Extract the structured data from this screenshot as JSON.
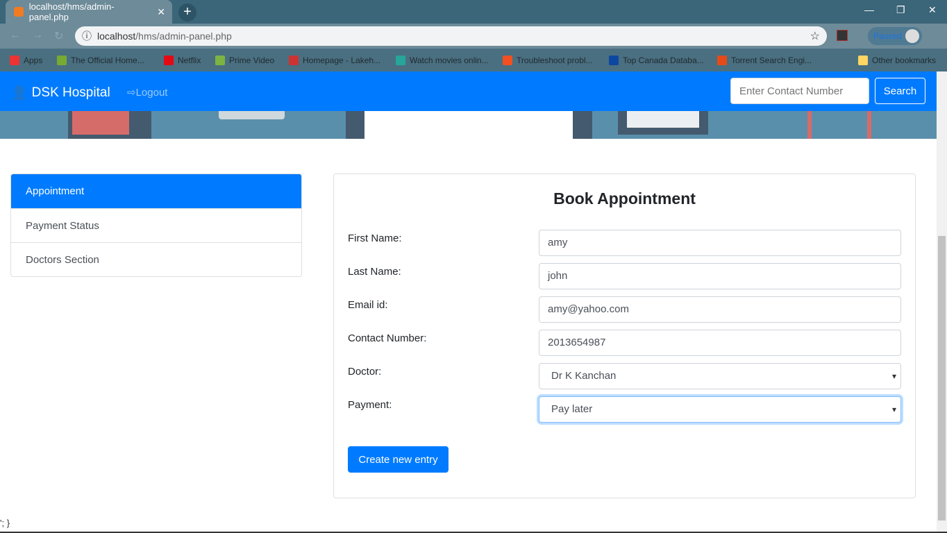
{
  "browser": {
    "tab_title": "localhost/hms/admin-panel.php",
    "url_host": "localhost",
    "url_path": "/hms/admin-panel.php",
    "profile_status": "Paused",
    "bookmarks": [
      {
        "label": "Apps",
        "color": "#e33"
      },
      {
        "label": "The Official Home...",
        "color": "#7a3"
      },
      {
        "label": "Netflix",
        "color": "#e50914"
      },
      {
        "label": "Prime Video",
        "color": "#7cb342"
      },
      {
        "label": "Homepage - Lakeh...",
        "color": "#c33"
      },
      {
        "label": "Watch movies onlin...",
        "color": "#26a69a"
      },
      {
        "label": "Troubleshoot probl...",
        "color": "#f25022"
      },
      {
        "label": "Top Canada Databa...",
        "color": "#0d47a1"
      },
      {
        "label": "Torrent Search Engi...",
        "color": "#e64a19"
      }
    ],
    "other_bookmarks": "Other bookmarks"
  },
  "navbar": {
    "brand": "DSK Hospital",
    "logout": "Logout",
    "search_placeholder": "Enter Contact Number",
    "search_button": "Search"
  },
  "sidebar": {
    "items": [
      {
        "label": "Appointment",
        "active": true
      },
      {
        "label": "Payment Status"
      },
      {
        "label": "Doctors Section"
      }
    ]
  },
  "form": {
    "title": "Book Appointment",
    "fields": [
      {
        "label": "First Name:",
        "value": "amy"
      },
      {
        "label": "Last Name:",
        "value": "john"
      },
      {
        "label": "Email id:",
        "value": "amy@yahoo.com"
      },
      {
        "label": "Contact Number:",
        "value": "2013654987"
      },
      {
        "label": "Doctor:",
        "value": "Dr K Kanchan"
      },
      {
        "label": "Payment:",
        "value": "Pay later"
      }
    ],
    "submit": "Create new entry"
  },
  "stray_text": "'; }",
  "colors": {
    "primary": "#007bff"
  }
}
